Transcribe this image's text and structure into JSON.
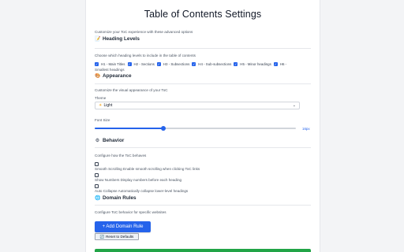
{
  "page": {
    "title": "Table of Contents Settings",
    "intro": "Customize your ToC experience with these advanced options"
  },
  "heading_levels": {
    "icon": "memo-icon",
    "title": "Heading Levels",
    "description": "Choose which heading levels to include in the table of contents",
    "items": [
      {
        "label": "H1 - Main Titles",
        "checked": true
      },
      {
        "label": "H2 - Sections",
        "checked": true
      },
      {
        "label": "H3 - Subsections",
        "checked": true
      },
      {
        "label": "H4 - Sub-subsections",
        "checked": true
      },
      {
        "label": "H5 - Minor headings",
        "checked": true
      },
      {
        "label": "H6 -",
        "checked": true
      }
    ],
    "wrap_text": "Smallest headings"
  },
  "appearance": {
    "icon": "palette-icon",
    "title": "Appearance",
    "description": "Customize the visual appearance of your ToC",
    "theme_label": "Theme",
    "theme_value": "Light",
    "theme_icon": "sun-icon",
    "font_size_label": "Font Size",
    "font_size_value": "16px",
    "font_size_fraction": 0.34
  },
  "behavior": {
    "icon": "gear-icon",
    "title": "Behavior",
    "description": "Configure how the ToC behaves",
    "options": [
      {
        "text": "Smooth Scrolling Enable smooth scrolling when clicking ToC links",
        "checked": false
      },
      {
        "text": "Show Numbers Display numbers before each heading",
        "checked": false
      },
      {
        "text": "Auto Collapse Automatically collapse lower-level headings",
        "checked": false
      }
    ]
  },
  "domain_rules": {
    "icon": "globe-icon",
    "title": "Domain Rules",
    "description": "Configure ToC behavior for specific websites",
    "add_button": "+ Add Domain Rule",
    "reset_button": "Reset to Defaults",
    "reset_icon": "reset-icon"
  },
  "colors": {
    "accent": "#2563eb",
    "save_bar": "#22a447"
  }
}
